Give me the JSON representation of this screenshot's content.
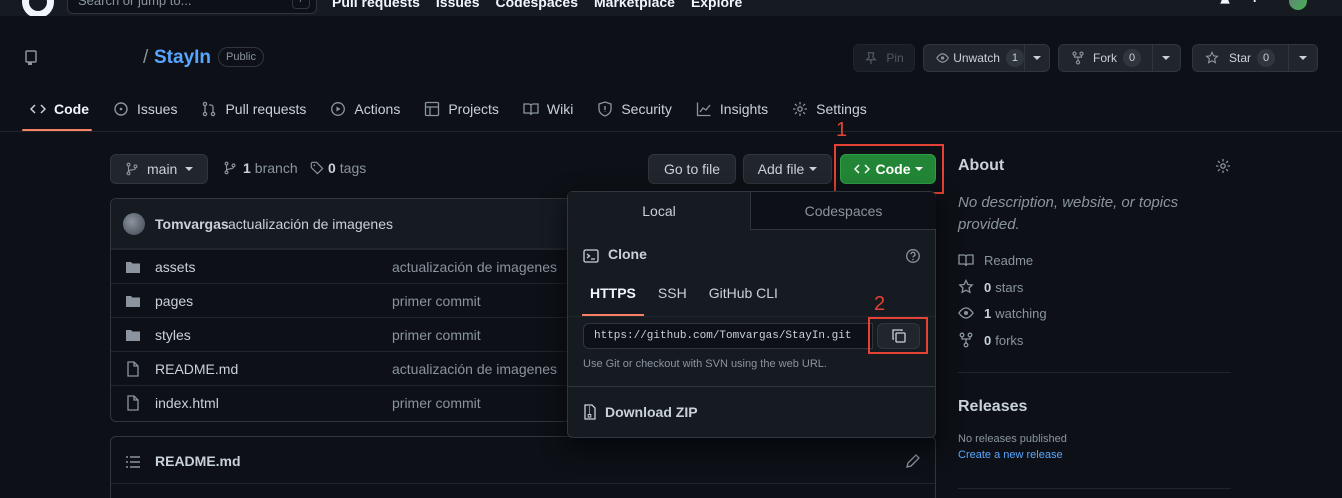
{
  "topbar": {
    "search_placeholder": "Search or jump to...",
    "search_key": "/",
    "nav": [
      "Pull requests",
      "Issues",
      "Codespaces",
      "Marketplace",
      "Explore"
    ],
    "plus": "+"
  },
  "repo": {
    "slash": "/",
    "name": "StayIn",
    "visibility": "Public",
    "pin_label": "Pin",
    "unwatch_label": "Unwatch",
    "unwatch_count": "1",
    "fork_label": "Fork",
    "fork_count": "0",
    "star_label": "Star",
    "star_count": "0"
  },
  "tabs": [
    {
      "label": "Code",
      "icon": "code-icon",
      "active": true
    },
    {
      "label": "Issues",
      "icon": "issue-icon"
    },
    {
      "label": "Pull requests",
      "icon": "pull-request-icon"
    },
    {
      "label": "Actions",
      "icon": "play-icon"
    },
    {
      "label": "Projects",
      "icon": "table-icon"
    },
    {
      "label": "Wiki",
      "icon": "book-icon"
    },
    {
      "label": "Security",
      "icon": "shield-icon"
    },
    {
      "label": "Insights",
      "icon": "graph-icon"
    },
    {
      "label": "Settings",
      "icon": "gear-icon"
    }
  ],
  "branch": {
    "current": "main",
    "branch_count": "1",
    "branch_word": "branch",
    "tag_count": "0",
    "tag_word": "tags"
  },
  "actions": {
    "go_to_file": "Go to file",
    "add_file": "Add file",
    "code": "Code"
  },
  "annotations": {
    "step1": "1",
    "step2": "2",
    "color": "#e34234"
  },
  "commit": {
    "author": "Tomvargas",
    "message": "actualización de imagenes"
  },
  "files": [
    {
      "name": "assets",
      "type": "folder",
      "commit": "actualización de imagenes"
    },
    {
      "name": "pages",
      "type": "folder",
      "commit": "primer commit"
    },
    {
      "name": "styles",
      "type": "folder",
      "commit": "primer commit"
    },
    {
      "name": "README.md",
      "type": "file",
      "commit": "actualización de imagenes"
    },
    {
      "name": "index.html",
      "type": "file",
      "commit": "primer commit"
    }
  ],
  "readme": {
    "title": "README.md"
  },
  "clone": {
    "tab_local": "Local",
    "tab_codespaces": "Codespaces",
    "title": "Clone",
    "protocols": [
      "HTTPS",
      "SSH",
      "GitHub CLI"
    ],
    "active_protocol": "HTTPS",
    "url": "https://github.com/Tomvargas/StayIn.git",
    "hint": "Use Git or checkout with SVN using the web URL.",
    "download_zip": "Download ZIP"
  },
  "about": {
    "title": "About",
    "description": "No description, website, or topics provided.",
    "readme": "Readme",
    "stars_count": "0",
    "stars_word": "stars",
    "watching_count": "1",
    "watching_word": "watching",
    "forks_count": "0",
    "forks_word": "forks"
  },
  "releases": {
    "title": "Releases",
    "none": "No releases published",
    "create": "Create a new release"
  },
  "colors": {
    "accent_green": "#238636",
    "link_blue": "#58a6ff",
    "tab_underline": "#f78166",
    "background": "#0d1117"
  }
}
